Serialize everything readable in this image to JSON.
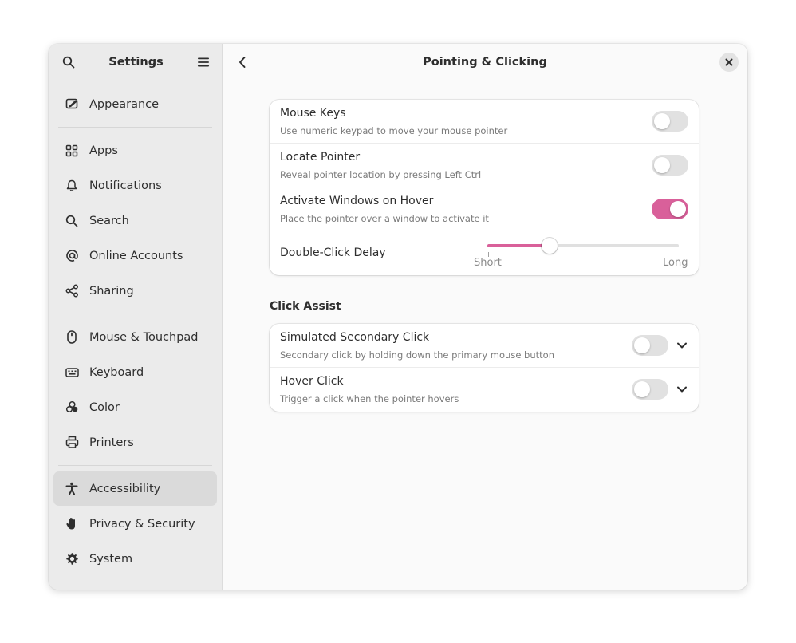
{
  "sidebar": {
    "title": "Settings",
    "items": [
      {
        "label": "Appearance",
        "icon": "appearance-icon"
      },
      {
        "label": "Apps",
        "icon": "apps-icon"
      },
      {
        "label": "Notifications",
        "icon": "bell-icon"
      },
      {
        "label": "Search",
        "icon": "search-icon"
      },
      {
        "label": "Online Accounts",
        "icon": "at-icon"
      },
      {
        "label": "Sharing",
        "icon": "share-icon"
      },
      {
        "label": "Mouse & Touchpad",
        "icon": "mouse-icon"
      },
      {
        "label": "Keyboard",
        "icon": "keyboard-icon"
      },
      {
        "label": "Color",
        "icon": "color-icon"
      },
      {
        "label": "Printers",
        "icon": "printer-icon"
      },
      {
        "label": "Accessibility",
        "icon": "accessibility-icon",
        "selected": true
      },
      {
        "label": "Privacy & Security",
        "icon": "hand-icon"
      },
      {
        "label": "System",
        "icon": "gear-icon"
      }
    ]
  },
  "header": {
    "title": "Pointing & Clicking"
  },
  "pointing": {
    "mouse_keys": {
      "title": "Mouse Keys",
      "subtitle": "Use numeric keypad to move your mouse pointer",
      "enabled": false
    },
    "locate_pointer": {
      "title": "Locate Pointer",
      "subtitle": "Reveal pointer location by pressing Left Ctrl",
      "enabled": false
    },
    "activate_hover": {
      "title": "Activate Windows on Hover",
      "subtitle": "Place the pointer over a window to activate it",
      "enabled": true
    },
    "double_click": {
      "title": "Double-Click Delay",
      "min_label": "Short",
      "max_label": "Long",
      "value": 0.33
    }
  },
  "click_assist": {
    "title": "Click Assist",
    "secondary": {
      "title": "Simulated Secondary Click",
      "subtitle": "Secondary click by holding down the primary mouse button",
      "enabled": false
    },
    "hover_click": {
      "title": "Hover Click",
      "subtitle": "Trigger a click when the pointer hovers",
      "enabled": false
    }
  },
  "colors": {
    "accent": "#d9609a",
    "sidebar_bg": "#ebebeb",
    "content_bg": "#fafafa"
  }
}
